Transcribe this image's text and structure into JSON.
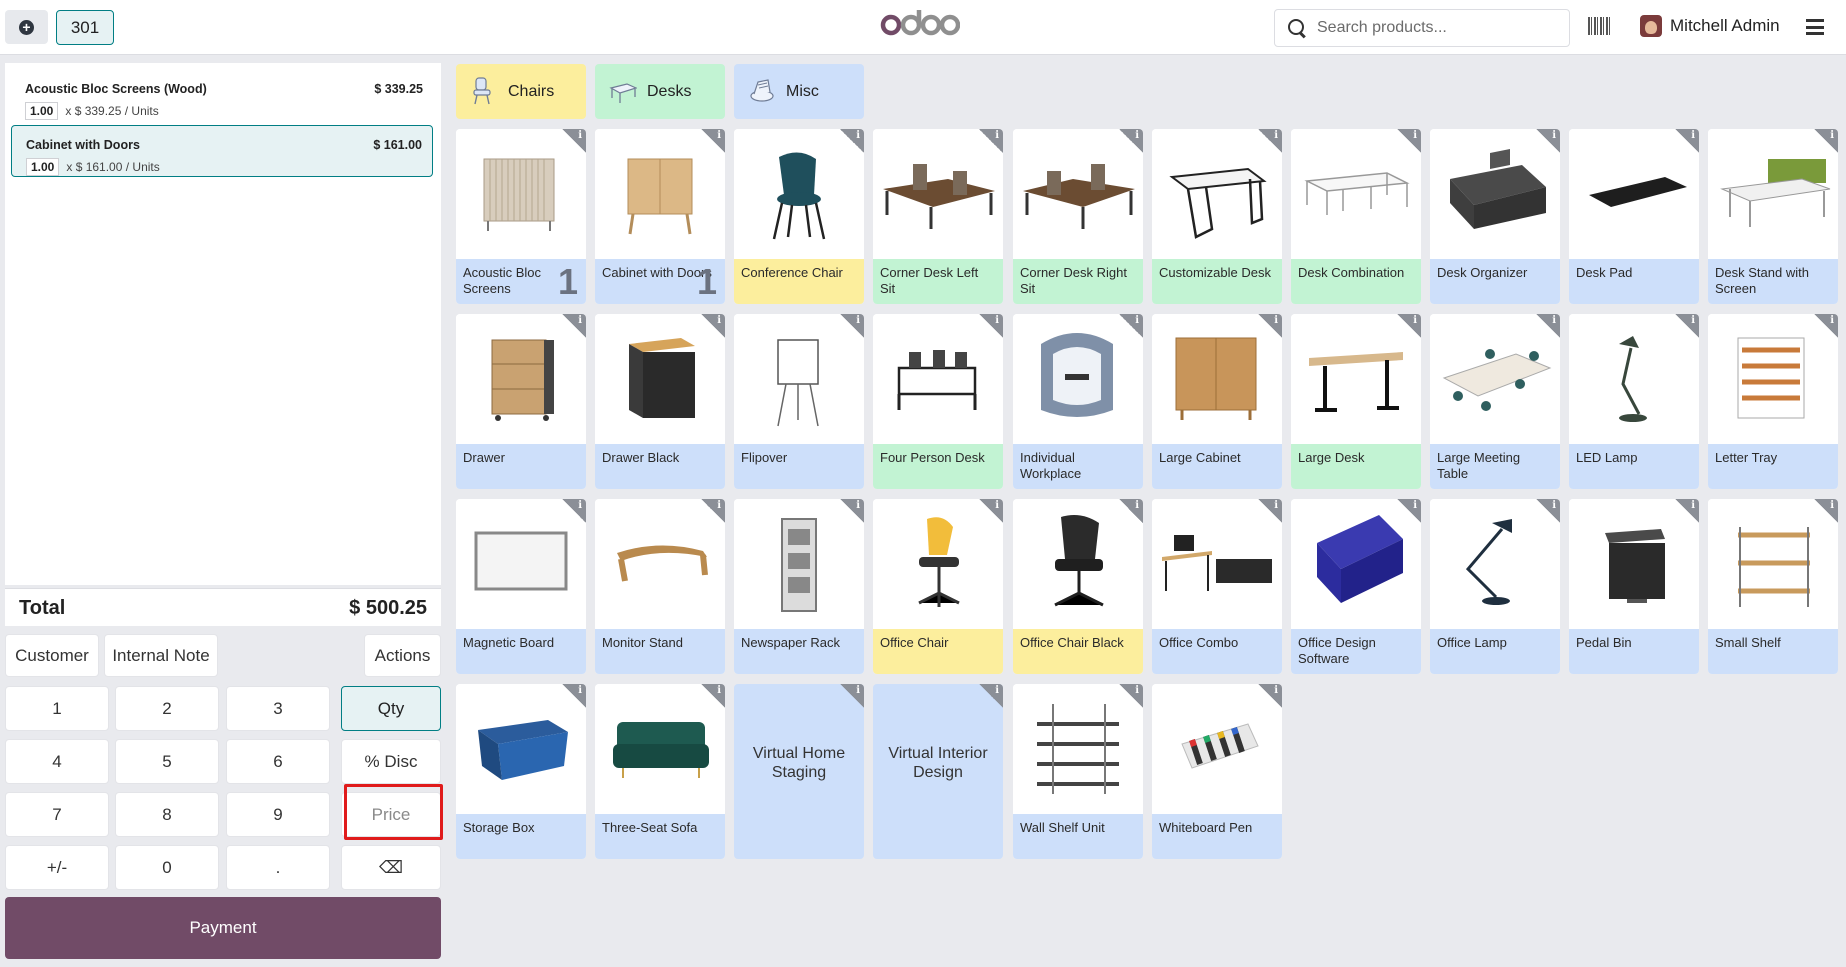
{
  "topbar": {
    "order_number": "301",
    "search_placeholder": "Search products...",
    "user_name": "Mitchell Admin"
  },
  "order": {
    "lines": [
      {
        "name": "Acoustic Bloc Screens (Wood)",
        "price": "$ 339.25",
        "qty": "1.00",
        "unit_info": "x $ 339.25 / Units",
        "selected": false
      },
      {
        "name": "Cabinet with Doors",
        "price": "$ 161.00",
        "qty": "1.00",
        "unit_info": "x $ 161.00 / Units",
        "selected": true
      }
    ],
    "total_label": "Total",
    "total_value": "$ 500.25"
  },
  "controls": {
    "customer": "Customer",
    "internal_note": "Internal Note",
    "actions": "Actions"
  },
  "numpad": {
    "k1": "1",
    "k2": "2",
    "k3": "3",
    "k4": "4",
    "k5": "5",
    "k6": "6",
    "k7": "7",
    "k8": "8",
    "k9": "9",
    "k0": "0",
    "plusminus": "+/-",
    "dot": ".",
    "qty": "Qty",
    "disc": "% Disc",
    "price": "Price",
    "backspace": "⌫"
  },
  "payment_label": "Payment",
  "categories": [
    {
      "name": "Chairs",
      "color": "#fcee9d"
    },
    {
      "name": "Desks",
      "color": "#c2f3d3"
    },
    {
      "name": "Misc",
      "color": "#cddffa"
    }
  ],
  "products": [
    {
      "name": "Acoustic Bloc Screens",
      "color": "blue",
      "count": "1"
    },
    {
      "name": "Cabinet with Doors",
      "color": "blue",
      "count": "1"
    },
    {
      "name": "Conference Chair",
      "color": "yellow"
    },
    {
      "name": "Corner Desk Left Sit",
      "color": "green"
    },
    {
      "name": "Corner Desk Right Sit",
      "color": "green"
    },
    {
      "name": "Customizable Desk",
      "color": "green"
    },
    {
      "name": "Desk Combination",
      "color": "green"
    },
    {
      "name": "Desk Organizer",
      "color": "blue"
    },
    {
      "name": "Desk Pad",
      "color": "blue"
    },
    {
      "name": "Desk Stand with Screen",
      "color": "blue"
    },
    {
      "name": "Drawer",
      "color": "blue"
    },
    {
      "name": "Drawer Black",
      "color": "blue"
    },
    {
      "name": "Flipover",
      "color": "blue"
    },
    {
      "name": "Four Person Desk",
      "color": "green"
    },
    {
      "name": "Individual Workplace",
      "color": "blue"
    },
    {
      "name": "Large Cabinet",
      "color": "blue"
    },
    {
      "name": "Large Desk",
      "color": "green"
    },
    {
      "name": "Large Meeting Table",
      "color": "blue"
    },
    {
      "name": "LED Lamp",
      "color": "blue"
    },
    {
      "name": "Letter Tray",
      "color": "blue"
    },
    {
      "name": "Magnetic Board",
      "color": "blue"
    },
    {
      "name": "Monitor Stand",
      "color": "blue"
    },
    {
      "name": "Newspaper Rack",
      "color": "blue"
    },
    {
      "name": "Office Chair",
      "color": "yellow"
    },
    {
      "name": "Office Chair Black",
      "color": "yellow"
    },
    {
      "name": "Office Combo",
      "color": "blue"
    },
    {
      "name": "Office Design Software",
      "color": "blue"
    },
    {
      "name": "Office Lamp",
      "color": "blue"
    },
    {
      "name": "Pedal Bin",
      "color": "blue"
    },
    {
      "name": "Small Shelf",
      "color": "blue"
    },
    {
      "name": "Storage Box",
      "color": "blue"
    },
    {
      "name": "Three-Seat Sofa",
      "color": "blue"
    },
    {
      "name": "Virtual Home Staging",
      "color": "blue",
      "virtual": true
    },
    {
      "name": "Virtual Interior Design",
      "color": "blue",
      "virtual": true
    },
    {
      "name": "Wall Shelf Unit",
      "color": "blue"
    },
    {
      "name": "Whiteboard Pen",
      "color": "blue"
    }
  ]
}
